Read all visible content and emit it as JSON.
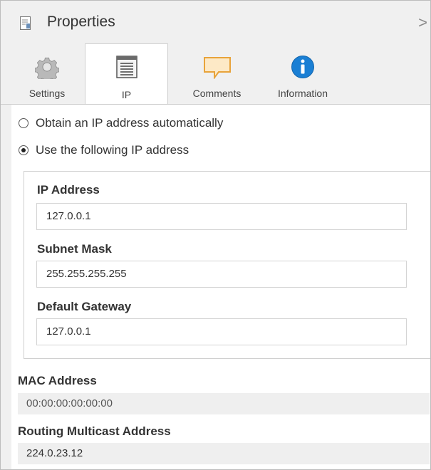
{
  "header": {
    "title": "Properties",
    "collapse_glyph": ">"
  },
  "tabs": [
    {
      "label": "Settings",
      "icon": "gear-icon",
      "active": false
    },
    {
      "label": "IP",
      "icon": "ip-list-icon",
      "active": true
    },
    {
      "label": "Comments",
      "icon": "comment-icon",
      "active": false
    },
    {
      "label": "Information",
      "icon": "info-icon",
      "active": false
    }
  ],
  "ip_mode": {
    "auto_label": "Obtain an IP address automatically",
    "manual_label": "Use the following IP address",
    "selected": "manual"
  },
  "ip_fields": {
    "ip_address_label": "IP Address",
    "ip_address_value": "127.0.0.1",
    "subnet_mask_label": "Subnet Mask",
    "subnet_mask_value": "255.255.255.255",
    "default_gateway_label": "Default Gateway",
    "default_gateway_value": "127.0.0.1"
  },
  "mac": {
    "label": "MAC Address",
    "value": "00:00:00:00:00:00"
  },
  "multicast": {
    "label": "Routing Multicast Address",
    "value": "224.0.23.12"
  },
  "colors": {
    "panel_bg": "#f0f0f0",
    "info_blue": "#1a7fd4",
    "comment_orange": "#e8a33a"
  }
}
